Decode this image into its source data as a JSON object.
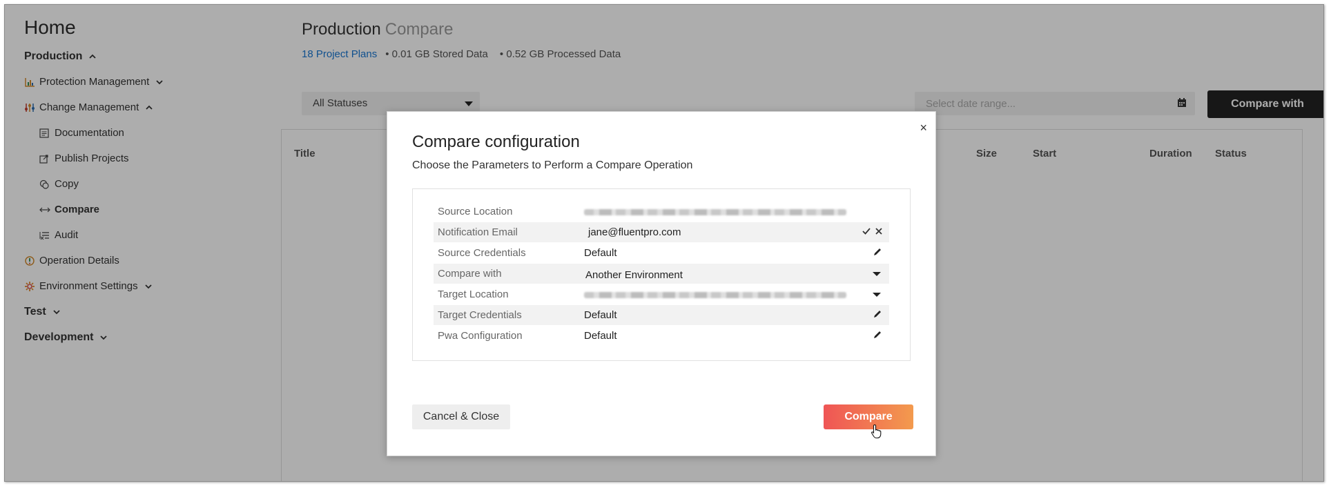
{
  "sidebar": {
    "home": "Home",
    "items": [
      {
        "label": "Production"
      },
      {
        "label": "Protection Management"
      },
      {
        "label": "Change Management"
      },
      {
        "label": "Documentation"
      },
      {
        "label": "Publish Projects"
      },
      {
        "label": "Copy"
      },
      {
        "label": "Compare"
      },
      {
        "label": "Audit"
      },
      {
        "label": "Operation Details"
      },
      {
        "label": "Environment Settings"
      },
      {
        "label": "Test"
      },
      {
        "label": "Development"
      }
    ]
  },
  "header": {
    "title": "Production",
    "subtitle": "Compare",
    "project_plans": "18 Project Plans",
    "stored": "• 0.01 GB Stored Data",
    "processed": "• 0.52 GB Processed Data"
  },
  "filters": {
    "status": "All Statuses",
    "date_placeholder": "Select date range...",
    "compare_with_button": "Compare with"
  },
  "table": {
    "columns": [
      "Title",
      "Size",
      "Start",
      "Duration",
      "Status"
    ]
  },
  "modal": {
    "title": "Compare configuration",
    "subtitle": "Choose the Parameters to Perform a Compare Operation",
    "close": "×",
    "rows": [
      {
        "key": "Source Location",
        "value": ""
      },
      {
        "key": "Notification Email",
        "value": "jane@fluentpro.com"
      },
      {
        "key": "Source Credentials",
        "value": "Default"
      },
      {
        "key": "Compare with",
        "value": "Another Environment"
      },
      {
        "key": "Target Location",
        "value": ""
      },
      {
        "key": "Target Credentials",
        "value": "Default"
      },
      {
        "key": "Pwa Configuration",
        "value": "Default"
      }
    ],
    "cancel_button": "Cancel & Close",
    "compare_button": "Compare"
  },
  "colors": {
    "accent_link": "#1976d2",
    "compare_gradient_start": "#ef5555",
    "compare_gradient_end": "#f39a4e",
    "dark_button": "#222222"
  }
}
